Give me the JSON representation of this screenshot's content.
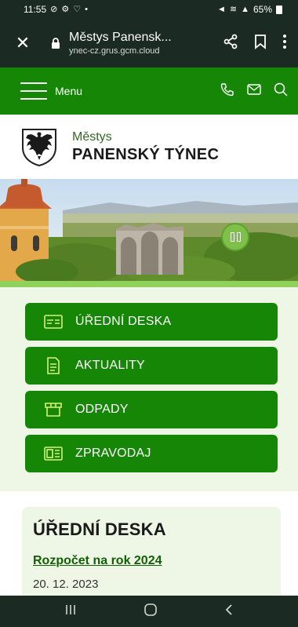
{
  "status_bar": {
    "time": "11:55",
    "battery": "65%"
  },
  "browser": {
    "title": "Městys Panensk...",
    "url": "ynec-cz.grus.gcm.cloud"
  },
  "nav": {
    "menu_label": "Menu"
  },
  "brand": {
    "line1": "Městys",
    "line2": "PANENSKÝ TÝNEC"
  },
  "quick_links": [
    {
      "label": "ÚŘEDNÍ DESKA",
      "icon": "board-icon"
    },
    {
      "label": "AKTUALITY",
      "icon": "document-icon"
    },
    {
      "label": "ODPADY",
      "icon": "waste-icon"
    },
    {
      "label": "ZPRAVODAJ",
      "icon": "newspaper-icon"
    }
  ],
  "notice_board": {
    "title": "ÚŘEDNÍ DESKA",
    "items": [
      {
        "title": "Rozpočet na rok 2024",
        "date": "20. 12. 2023"
      }
    ]
  },
  "colors": {
    "brand_green": "#168607",
    "light_green": "#eef6e5",
    "system_bar": "#1c2a24"
  }
}
